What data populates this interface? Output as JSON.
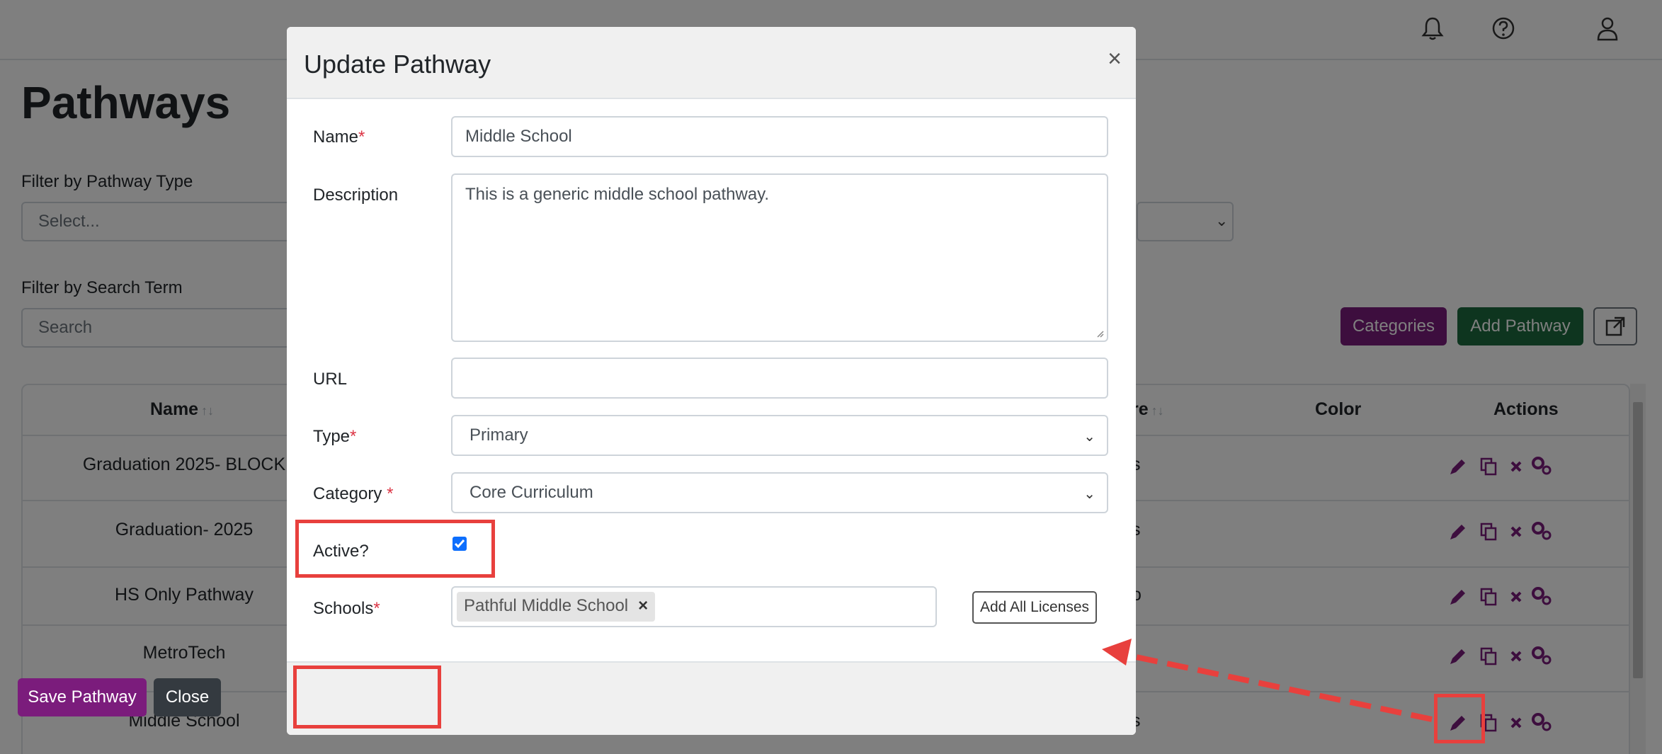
{
  "page": {
    "title": "Pathways",
    "filter_type_label": "Filter by Pathway Type",
    "filter_type_value": "Select...",
    "filter_search_label": "Filter by Search Term",
    "search_placeholder": "Search",
    "categories_button": "Categories",
    "add_pathway_button": "Add Pathway",
    "table": {
      "headers": [
        "Name",
        "re",
        "Color",
        "Actions"
      ],
      "sort_icon": "↑↓",
      "rows": [
        {
          "name": "Graduation 2025- BLOCK",
          "type_fragment": "s"
        },
        {
          "name": "Graduation- 2025",
          "type_fragment": "s"
        },
        {
          "name": "HS Only Pathway",
          "type_fragment": "o"
        },
        {
          "name": "MetroTech",
          "type_fragment": ""
        },
        {
          "name": "Middle School",
          "type_fragment": "s"
        }
      ]
    },
    "icons": [
      "bell-icon",
      "help-icon",
      "user-icon",
      "external-link-icon",
      "pencil-icon",
      "copy-icon",
      "delete-icon",
      "settings-icon"
    ]
  },
  "modal": {
    "title": "Update Pathway",
    "close_glyph": "×",
    "name_label": "Name",
    "name_value": "Middle School",
    "description_label": "Description",
    "description_value": "This is a generic middle school pathway.",
    "url_label": "URL",
    "url_value": "",
    "type_label": "Type",
    "type_value": "Primary",
    "category_label": "Category ",
    "category_value": "Core Curriculum",
    "active_label": "Active?",
    "active_checked": true,
    "schools_label": "Schools",
    "school_tag": "Pathful Middle School",
    "tag_remove_glyph": "×",
    "add_all_button": "Add All Licenses",
    "save_button": "Save Pathway",
    "close_button": "Close",
    "required_marker": "*"
  },
  "colors": {
    "accent_purple": "#7b1c7c",
    "accent_green": "#1c6b3e",
    "dark_button": "#343a40",
    "annotation_red": "#e8403d",
    "checkbox_blue": "#0d6efd"
  }
}
